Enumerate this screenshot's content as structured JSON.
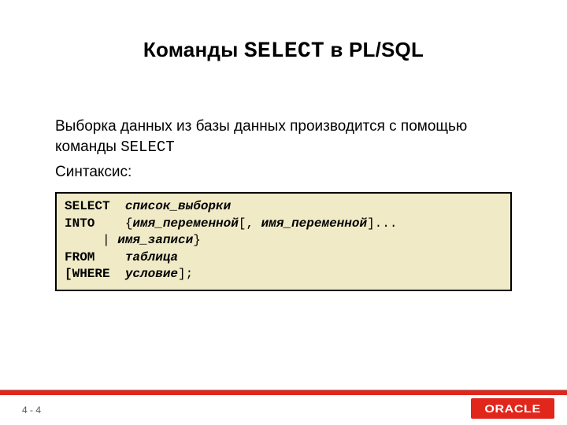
{
  "title": {
    "prefix": "Команды ",
    "keyword": "SELECT",
    "suffix": " в PL/SQL"
  },
  "body": {
    "line1_prefix": "Выборка данных из базы данных производится с помощью команды ",
    "line1_keyword": "SELECT",
    "line2": "Синтаксис:"
  },
  "code": {
    "l1_kw": "SELECT  ",
    "l1_arg": "список_выборки",
    "l2_kw": "INTO    ",
    "l2_p1": "{",
    "l2_a1": "имя_переменной",
    "l2_p2": "[, ",
    "l2_a2": "имя_переменной",
    "l2_p3": "]...",
    "l3_pad": "     ",
    "l3_p1": "| ",
    "l3_a1": "имя_записи",
    "l3_p2": "}",
    "l4_kw": "FROM    ",
    "l4_a1": "таблица",
    "l5_kw": "[WHERE  ",
    "l5_a1": "условие",
    "l5_p1": "];"
  },
  "footer": {
    "page": "4 - 4",
    "logo": "ORACLE"
  }
}
